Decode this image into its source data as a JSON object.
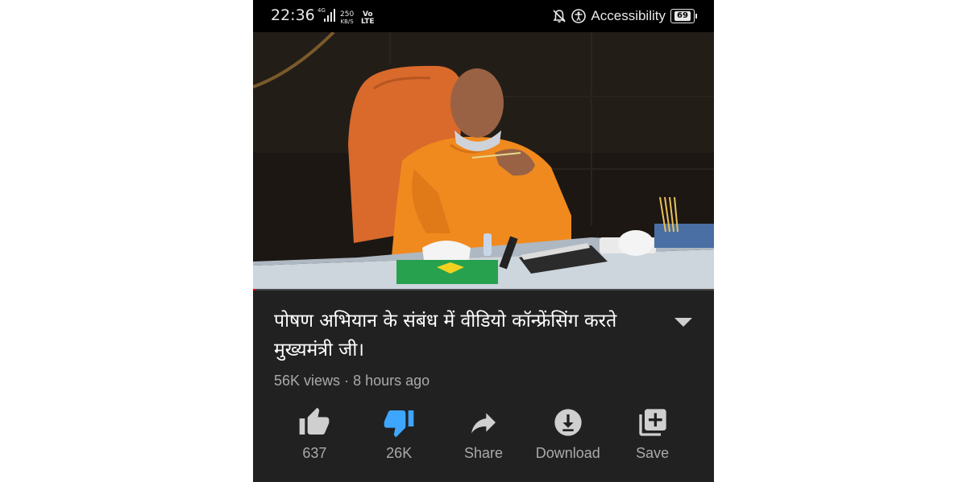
{
  "status_bar": {
    "time": "22:36",
    "network": "4G",
    "speed_value": "250",
    "speed_unit": "KB/S",
    "volte_top": "Vo",
    "volte_bottom": "LTE",
    "accessibility_label": "Accessibility",
    "battery_level": "69"
  },
  "video": {
    "progress_fraction": 0.006,
    "progress_color": "#ff0000"
  },
  "details": {
    "title": "पोषण अभियान के संबंध में वीडियो कॉन्फ्रेंसिंग करते मुख्यमंत्री जी।",
    "views": "56K views",
    "age": "8 hours ago",
    "separator": "·"
  },
  "actions": [
    {
      "icon": "thumb-up-icon",
      "label": "637",
      "color": "#cfcfcf"
    },
    {
      "icon": "thumb-down-icon",
      "label": "26K",
      "color": "#3ea6ff"
    },
    {
      "icon": "share-icon",
      "label": "Share",
      "color": "#cfcfcf"
    },
    {
      "icon": "download-icon",
      "label": "Download",
      "color": "#cfcfcf"
    },
    {
      "icon": "save-playlist-icon",
      "label": "Save",
      "color": "#cfcfcf"
    }
  ]
}
